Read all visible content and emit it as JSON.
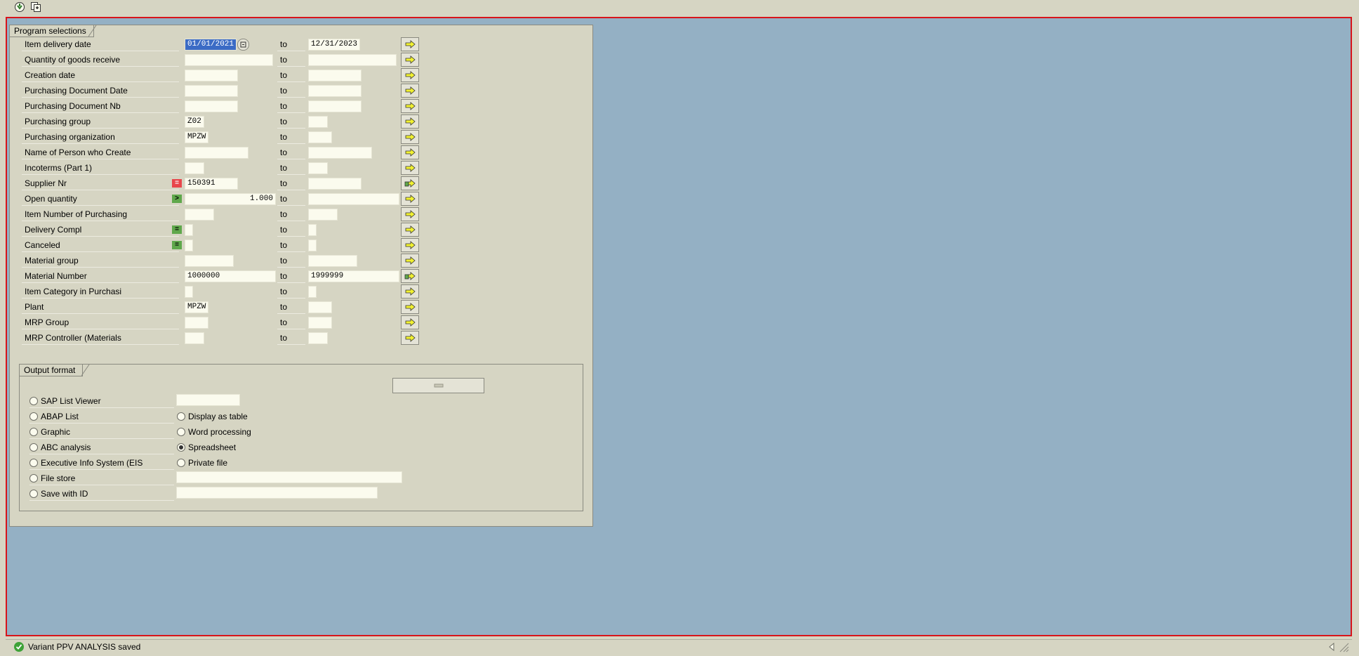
{
  "toolbar": {
    "execute_icon": "execute-icon",
    "variant_icon": "get-variant-icon"
  },
  "selections": {
    "title": "Program selections",
    "to_label": "to",
    "rows": [
      {
        "label": "Item delivery date",
        "from": "01/01/2021",
        "to": "12/31/2023",
        "op": ""
      },
      {
        "label": "Quantity of goods receive",
        "from": "",
        "to": "",
        "op": ""
      },
      {
        "label": "Creation date",
        "from": "",
        "to": "",
        "op": ""
      },
      {
        "label": "Purchasing Document Date",
        "from": "",
        "to": "",
        "op": ""
      },
      {
        "label": "Purchasing Document Nb",
        "from": "",
        "to": "",
        "op": ""
      },
      {
        "label": "Purchasing group",
        "from": "Z02",
        "to": "",
        "op": ""
      },
      {
        "label": "Purchasing organization",
        "from": "MPZW",
        "to": "",
        "op": ""
      },
      {
        "label": "Name of Person who Create",
        "from": "",
        "to": "",
        "op": ""
      },
      {
        "label": "Incoterms (Part 1)",
        "from": "",
        "to": "",
        "op": ""
      },
      {
        "label": "Supplier Nr",
        "from": "150391",
        "to": "",
        "op": "="
      },
      {
        "label": "Open quantity",
        "from": "1.000",
        "to": "",
        "op": ">"
      },
      {
        "label": "Item Number of Purchasing",
        "from": "",
        "to": "",
        "op": ""
      },
      {
        "label": "Delivery Compl",
        "from": "",
        "to": "",
        "op": "="
      },
      {
        "label": "Canceled",
        "from": "",
        "to": "",
        "op": "="
      },
      {
        "label": "Material group",
        "from": "",
        "to": "",
        "op": ""
      },
      {
        "label": "Material Number",
        "from": "1000000",
        "to": "1999999",
        "op": ""
      },
      {
        "label": "Item Category in Purchasi",
        "from": "",
        "to": "",
        "op": ""
      },
      {
        "label": "Plant",
        "from": "MPZW",
        "to": "",
        "op": ""
      },
      {
        "label": "MRP Group",
        "from": "",
        "to": "",
        "op": ""
      },
      {
        "label": "MRP Controller (Materials",
        "from": "",
        "to": "",
        "op": ""
      }
    ]
  },
  "output": {
    "title": "Output format",
    "options_left": [
      {
        "label": "SAP List Viewer",
        "selected": false
      },
      {
        "label": "ABAP List",
        "selected": false
      },
      {
        "label": "Graphic",
        "selected": false
      },
      {
        "label": "ABC analysis",
        "selected": false
      },
      {
        "label": "Executive Info System (EIS",
        "selected": false
      },
      {
        "label": "File store",
        "selected": false
      },
      {
        "label": "Save with ID",
        "selected": false
      }
    ],
    "options_right": [
      {
        "label": "Display as table",
        "selected": false
      },
      {
        "label": "Word processing",
        "selected": false
      },
      {
        "label": "Spreadsheet",
        "selected": true
      },
      {
        "label": "Private file",
        "selected": false
      }
    ],
    "sap_list_viewer_value": "",
    "file_store_value": "",
    "save_with_id_value": ""
  },
  "status": {
    "message": "Variant PPV ANALYSIS saved",
    "icon": "success-check-icon"
  },
  "colors": {
    "background": "#d6d5c3",
    "workspace": "#94b0c4",
    "highlight_border": "#d8141a",
    "field": "#fbfbee",
    "selection": "#3b6bc5"
  }
}
